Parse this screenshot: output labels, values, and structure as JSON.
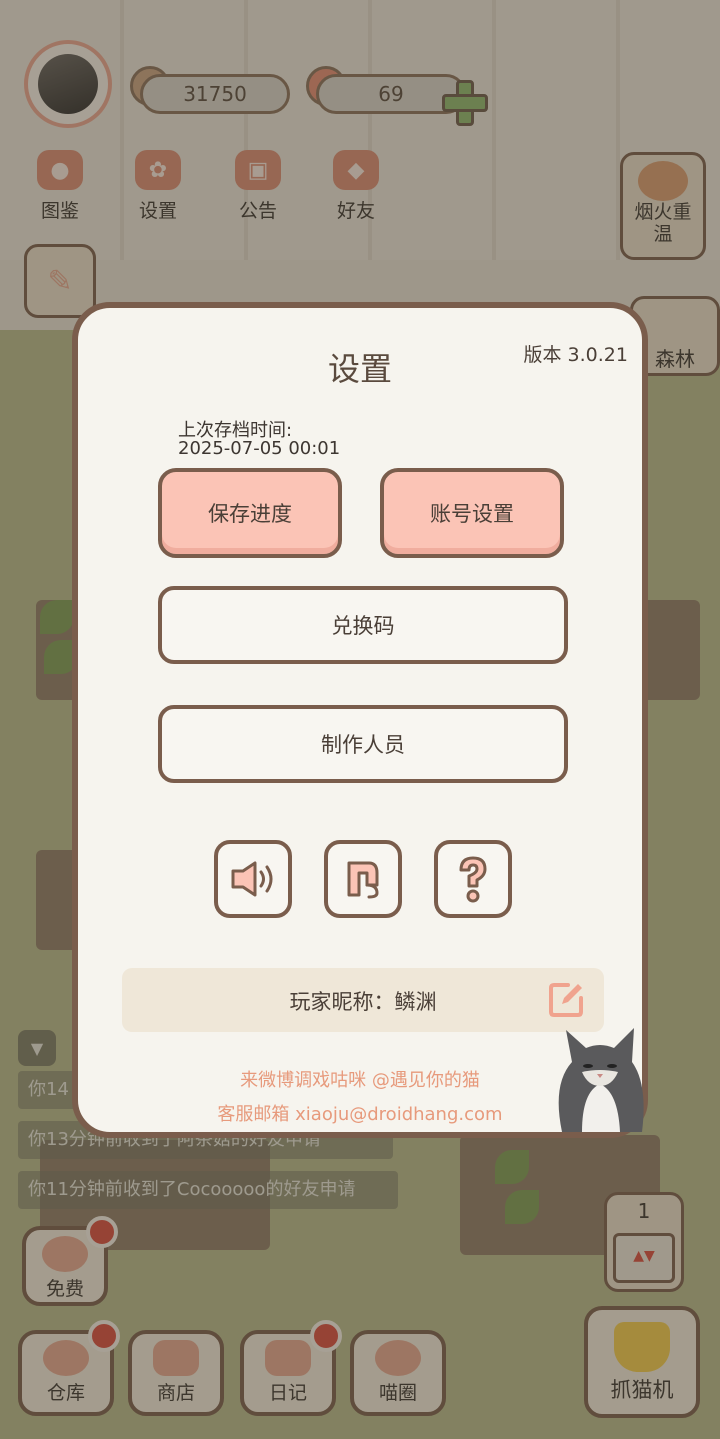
{
  "top_bar": {
    "coins": "31750",
    "hearts": "69"
  },
  "menu": [
    {
      "label": "图鉴",
      "icon": "cat-face-icon"
    },
    {
      "label": "设置",
      "icon": "gear-icon"
    },
    {
      "label": "公告",
      "icon": "gift-icon"
    },
    {
      "label": "好友",
      "icon": "friends-icon"
    }
  ],
  "side": {
    "fireworks": "烟火重温",
    "forest": "森林"
  },
  "notifications": [
    "你14",
    "你13分钟前收到了阿茶菇的好友申请",
    "你11分钟前收到了Cocooooo的好友申请"
  ],
  "free_label": "免费",
  "queue_count": "1",
  "bottom_bar": [
    {
      "label": "仓库",
      "badge": true
    },
    {
      "label": "商店",
      "badge": false
    },
    {
      "label": "日记",
      "badge": true
    },
    {
      "label": "喵圈",
      "badge": false
    }
  ],
  "claw_label": "抓猫机",
  "dialog": {
    "title": "设置",
    "version": "版本 3.0.21",
    "save_time_label": "上次存档时间:",
    "save_time_value": "2025-07-05 00:01",
    "save_button": "保存进度",
    "account_button": "账号设置",
    "redeem_button": "兑换码",
    "credits_button": "制作人员",
    "nickname_label": "玩家昵称：",
    "nickname_value": "鳞渊",
    "nickname_full": "玩家昵称：鳞渊",
    "footer_weibo": "来微博调戏咕咪 @遇见你的猫",
    "footer_email": "客服邮箱 xiaoju@droidhang.com"
  },
  "colors": {
    "accent_pink": "#fbc4b6",
    "border_brown": "#7a5d4c",
    "footer_text": "#e79a7c"
  }
}
